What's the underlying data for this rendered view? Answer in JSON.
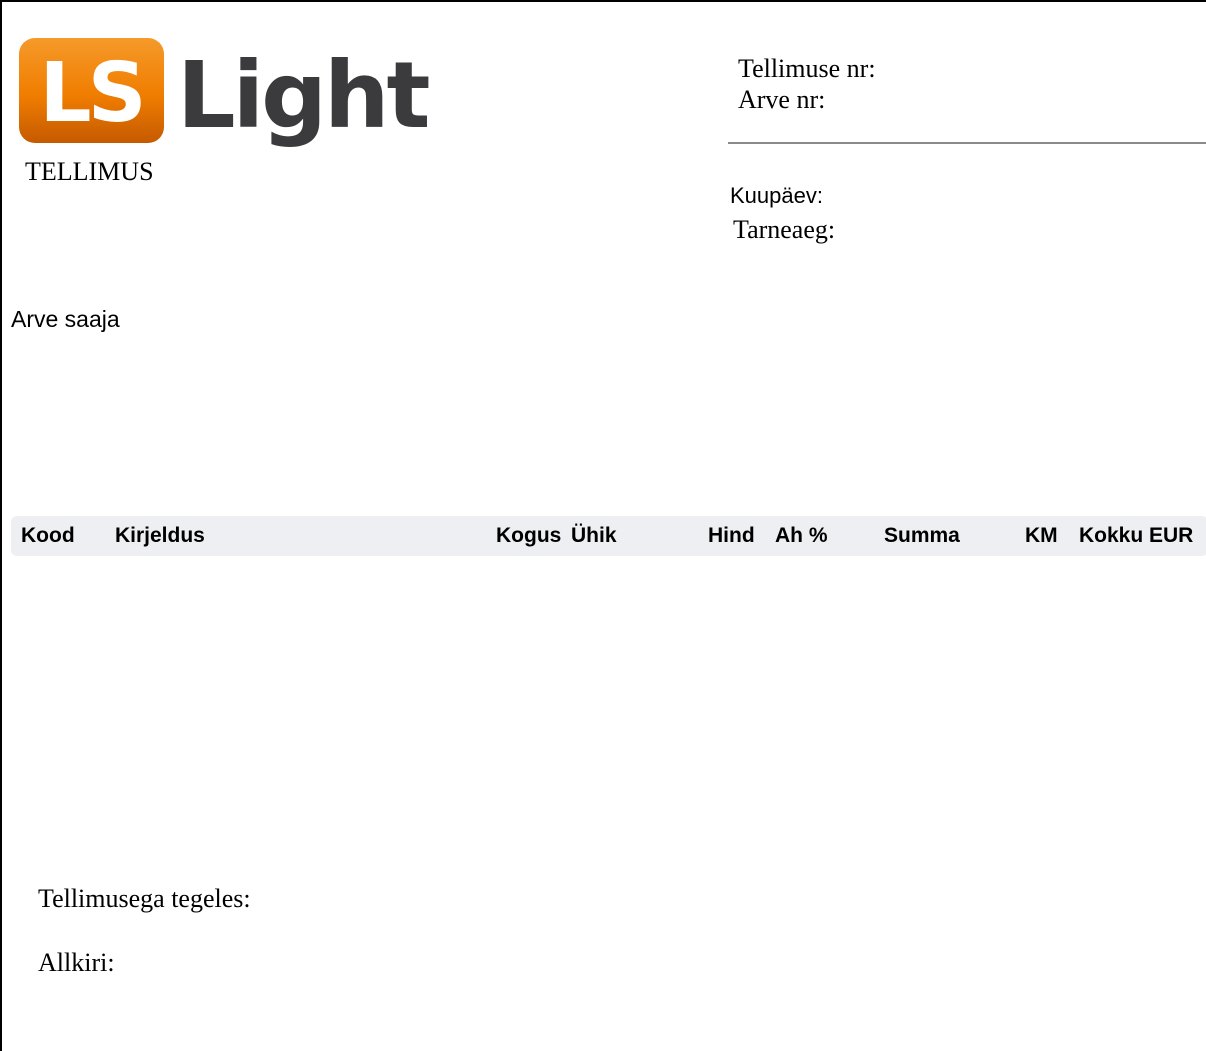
{
  "logo": {
    "mark_text": "LS",
    "word_text": "Light",
    "colors": {
      "orange": "#f07d00",
      "orange_dark": "#c55a00",
      "word": "#3b3b3d"
    }
  },
  "document": {
    "title": "TELLIMUS"
  },
  "header_right": {
    "order_no_label": "Tellimuse nr:",
    "invoice_no_label": "Arve nr:",
    "date_label": "Kuupäev:",
    "delivery_label": "Tarneaeg:"
  },
  "recipient": {
    "label": "Arve saaja"
  },
  "table": {
    "columns": [
      "Kood",
      "Kirjeldus",
      "Kogus",
      "Ühik",
      "Hind",
      "Ah %",
      "Summa",
      "KM",
      "Kokku EUR"
    ],
    "rows": []
  },
  "footer": {
    "handled_by_label": "Tellimusega tegeles:",
    "signature_label": "Allkiri:"
  }
}
